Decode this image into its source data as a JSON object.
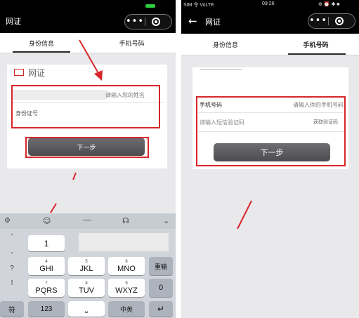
{
  "left": {
    "app_title": "网证",
    "nav_dots": "•••",
    "tabs": [
      "身份信息",
      "手机号码"
    ],
    "card_logo_text": "网证",
    "name_placeholder": "请输入您的姓名",
    "id_label": "身份证号",
    "next_button": "下一步",
    "keyboard": {
      "side_chars": [
        "'",
        "?",
        "!"
      ],
      "row1": {
        "key1": "1"
      },
      "row2": [
        {
          "main": "GHI",
          "sub": "4"
        },
        {
          "main": "JKL",
          "sub": "5"
        },
        {
          "main": "MNO",
          "sub": "6"
        }
      ],
      "row3": [
        {
          "main": "PQRS",
          "sub": "7"
        },
        {
          "main": "TUV",
          "sub": "8"
        },
        {
          "main": "WXYZ",
          "sub": "9"
        }
      ],
      "reenter": "重输",
      "zero": "0",
      "symbols": "符",
      "num123": "123",
      "lang": "中英",
      "return_icon": "↵"
    }
  },
  "right": {
    "status": {
      "carrier": "SIM 令 VoLTE",
      "time": "09:26",
      "icons": "⊕ ⏰ ✱ ■"
    },
    "app_title": "网证",
    "nav_dots": "•••",
    "tabs": [
      "身份信息",
      "手机号码"
    ],
    "phone_label": "手机号码",
    "phone_placeholder": "请输入你的手机号码",
    "sms_placeholder": "请输入短信验证码",
    "get_code": "获取验证码",
    "next_button": "下一步"
  },
  "colors": {
    "highlight_red": "#d8262a",
    "button_dark": "#5a5a5e",
    "page_bg": "#e9e9ec"
  }
}
